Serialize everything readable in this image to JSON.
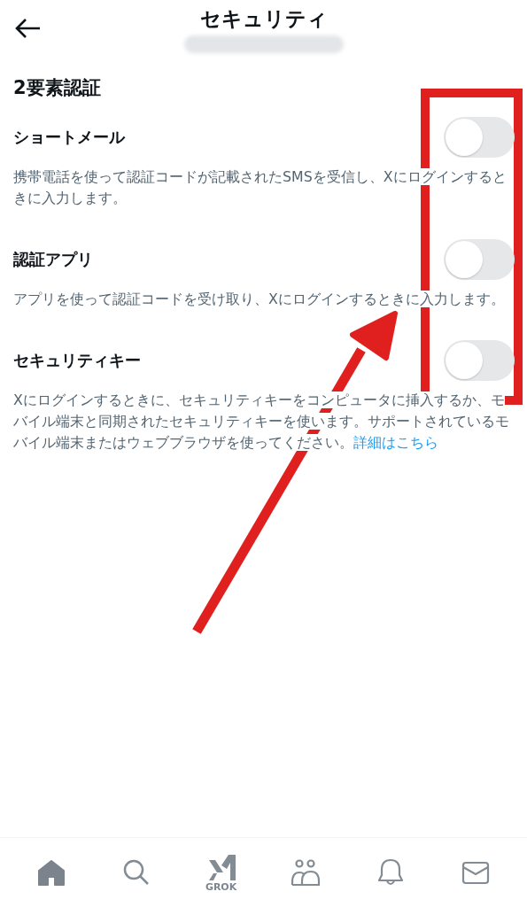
{
  "header": {
    "title": "セキュリティ",
    "subtitle_redacted": true
  },
  "section": {
    "title": "2要素認証"
  },
  "options": [
    {
      "title": "ショートメール",
      "description": "携帯電話を使って認証コードが記載されたSMSを受信し、Xにログインするときに入力します。",
      "on": false
    },
    {
      "title": "認証アプリ",
      "description": "アプリを使って認証コードを受け取り、Xにログインするときに入力します。",
      "on": false
    },
    {
      "title": "セキュリティキー",
      "description": "Xにログインするときに、セキュリティキーをコンピュータに挿入するか、モバイル端末と同期されたセキュリティキーを使います。サポートされているモバイル端末またはウェブブラウザを使ってください。",
      "link": "詳細はこちら",
      "on": false
    }
  ],
  "nav": [
    {
      "kind": "home",
      "selected": true
    },
    {
      "kind": "search",
      "selected": false
    },
    {
      "kind": "grok",
      "label": "GROK",
      "selected": false
    },
    {
      "kind": "people",
      "selected": false
    },
    {
      "kind": "bell",
      "selected": false
    },
    {
      "kind": "mail",
      "selected": false
    }
  ]
}
